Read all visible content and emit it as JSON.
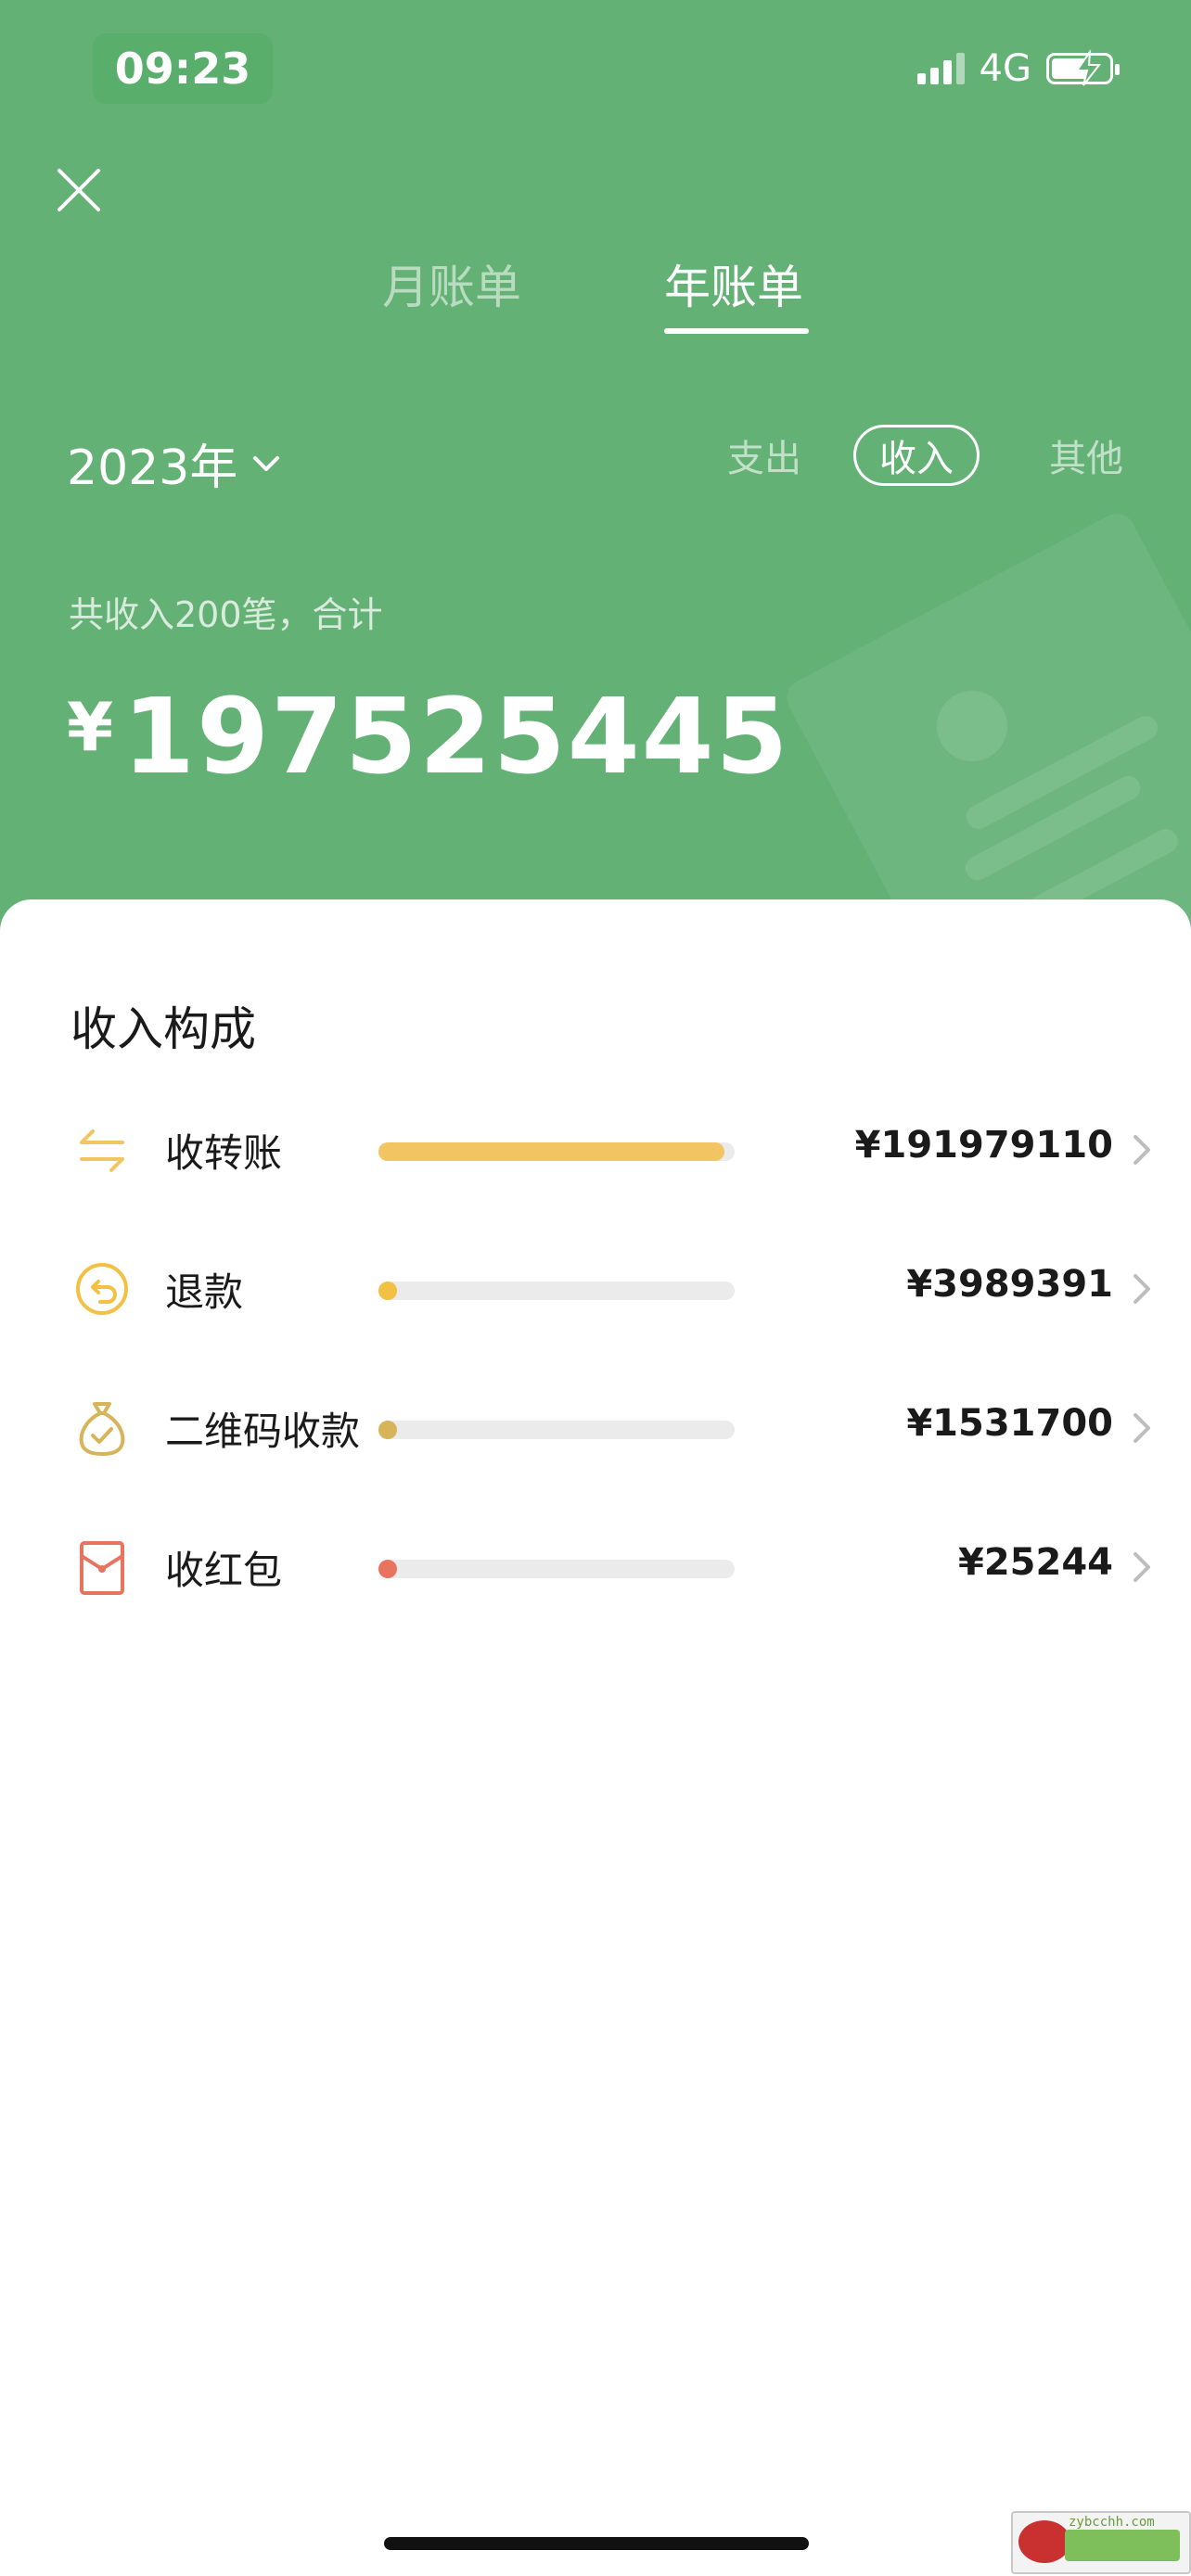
{
  "status_bar": {
    "time": "09:23",
    "network": "4G"
  },
  "tabs": [
    {
      "label": "月账单",
      "active": false
    },
    {
      "label": "年账单",
      "active": true
    }
  ],
  "year_selector": {
    "label": "2023年"
  },
  "filters": {
    "expense": "支出",
    "income": "收入",
    "other": "其他",
    "selected": "收入"
  },
  "summary": {
    "text": "共收入200笔，合计",
    "currency": "¥",
    "total": "197525445"
  },
  "composition": {
    "title": "收入构成",
    "items": [
      {
        "label": "收转账",
        "amount": "¥191979110",
        "icon": "transfer-icon",
        "ratio": 0.972,
        "color": "#f2c562"
      },
      {
        "label": "退款",
        "amount": "¥3989391",
        "icon": "refund-icon",
        "ratio": 0.02,
        "color": "#f2c042"
      },
      {
        "label": "二维码收款",
        "amount": "¥1531700",
        "icon": "money-bag-icon",
        "ratio": 0.008,
        "color": "#d7b45a"
      },
      {
        "label": "收红包",
        "amount": "¥25244",
        "icon": "red-packet-icon",
        "ratio": 0.0001,
        "color": "#e8735e"
      }
    ]
  },
  "colors": {
    "header_bg": "#64b176",
    "transfer": "#f2c562",
    "refund": "#f2c042",
    "qr": "#d7b45a",
    "red_packet": "#e8735e"
  }
}
